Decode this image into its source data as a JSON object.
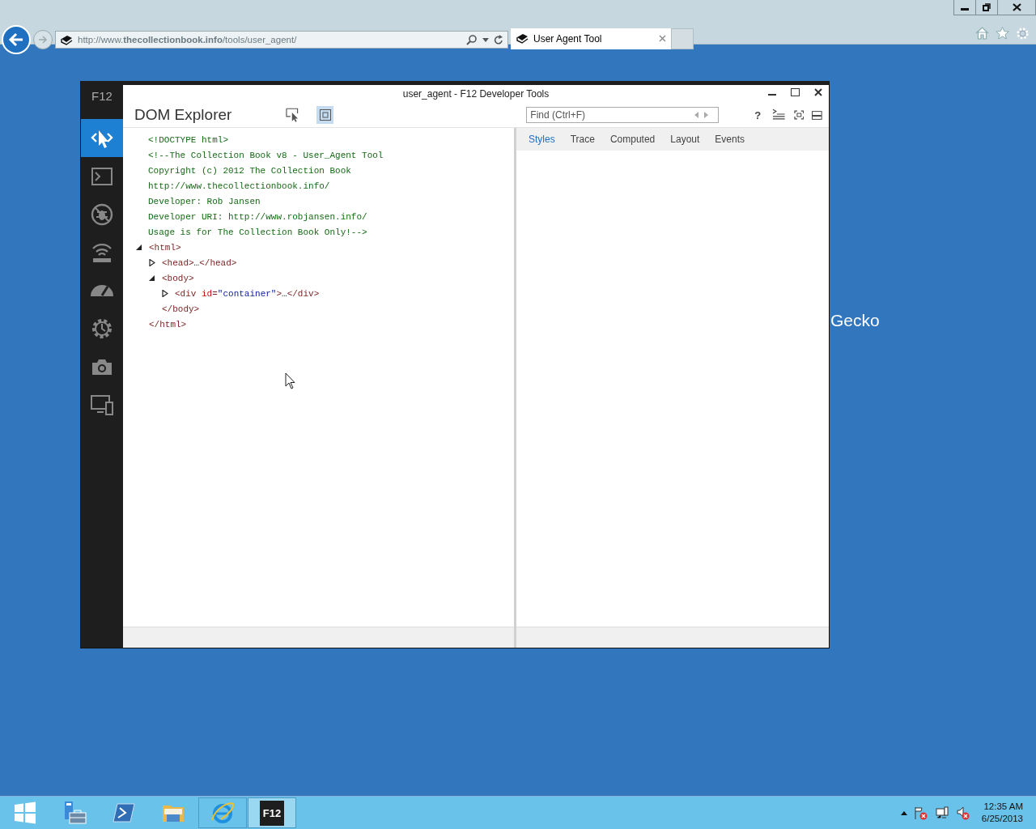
{
  "browser": {
    "url": "http://www.**thecollectionbook.info**/tools/user_agent/",
    "tabs": [
      {
        "label": "User Agent Tool",
        "selected": true
      }
    ]
  },
  "page": {
    "text": "Gecko"
  },
  "devtools": {
    "title": "user_agent - F12 Developer Tools",
    "brand": "F12",
    "tools": [
      {
        "selected": true
      },
      {
        "selected": false
      },
      {
        "selected": false
      },
      {
        "selected": false
      },
      {
        "selected": false
      },
      {
        "selected": false
      },
      {
        "selected": false
      },
      {
        "selected": false
      }
    ],
    "panel_title": "DOM Explorer",
    "highlight_on": true,
    "find": {
      "placeholder": "Find (Ctrl+F)"
    },
    "help": "?",
    "dom_tree": [
      {
        "kind": "doctype",
        "text": "<!DOCTYPE html>"
      },
      {
        "kind": "comment",
        "lines": [
          "<!--The Collection Book v8 - User_Agent Tool",
          "Copyright (c) 2012 The Collection Book",
          "http://www.thecollectionbook.info/",
          "Developer: Rob Jansen",
          "Developer URI: http://www.robjansen.info/",
          "Usage is for The Collection Book Only!-->"
        ]
      },
      {
        "kind": "element",
        "expanded": true,
        "open": [
          {
            "kind": "tag",
            "text": "<html>"
          }
        ],
        "close": "</html>",
        "children": [
          {
            "kind": "element",
            "expanded": false,
            "open": [
              {
                "kind": "tag",
                "text": "<head>"
              },
              {
                "kind": "plain",
                "text": "…"
              },
              {
                "kind": "tag",
                "text": "</head>"
              }
            ]
          },
          {
            "kind": "element",
            "expanded": true,
            "open": [
              {
                "kind": "tag",
                "text": "<body>"
              }
            ],
            "close": "</body>",
            "children": [
              {
                "kind": "element",
                "expanded": false,
                "open": [
                  {
                    "kind": "tag",
                    "text": "<div "
                  },
                  {
                    "kind": "attr",
                    "text": "id"
                  },
                  {
                    "kind": "tag",
                    "text": "="
                  },
                  {
                    "kind": "value",
                    "text": "\"container\""
                  },
                  {
                    "kind": "tag",
                    "text": ">"
                  },
                  {
                    "kind": "plain",
                    "text": "…"
                  },
                  {
                    "kind": "tag",
                    "text": "</div>"
                  }
                ]
              }
            ]
          }
        ]
      }
    ],
    "side_tabs": [
      {
        "label": "Styles",
        "selected": true
      },
      {
        "label": "Trace",
        "selected": false
      },
      {
        "label": "Computed",
        "selected": false
      },
      {
        "label": "Layout",
        "selected": false
      },
      {
        "label": "Events",
        "selected": false
      }
    ]
  },
  "taskbar": {
    "apps": [
      {
        "selected": false
      },
      {
        "selected": false
      },
      {
        "selected": false
      },
      {
        "selected": false
      },
      {
        "selected": false,
        "running": true
      },
      {
        "selected": true,
        "running": true,
        "label": "F12"
      }
    ],
    "time": "12:35 AM",
    "date": "6/25/2013"
  }
}
